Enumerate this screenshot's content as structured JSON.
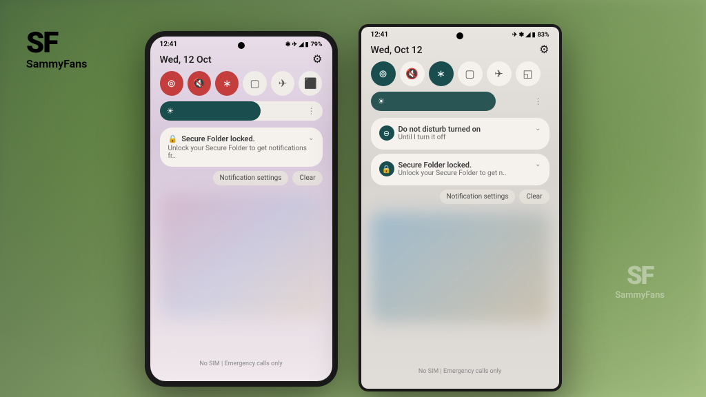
{
  "watermark": {
    "logo": "SF",
    "name": "SammyFans"
  },
  "phone_left": {
    "status": {
      "time": "12:41",
      "icons": "✱ ✈ ◢ ▮",
      "battery": "79%"
    },
    "date": "Wed, 12 Oct",
    "toggles": {
      "wifi": "wifi",
      "mute": "mute",
      "bluetooth": "bluetooth",
      "power": "power-saving",
      "airplane": "airplane",
      "flashlight": "flashlight"
    },
    "notification": {
      "title": "Secure Folder locked.",
      "body": "Unlock your Secure Folder to get notifications fr.."
    },
    "actions": {
      "settings": "Notification settings",
      "clear": "Clear"
    },
    "sim": "No SIM | Emergency calls only"
  },
  "phone_right": {
    "status": {
      "time": "12:41",
      "icons": "✈ ✱ ◢ ▮",
      "battery": "83%"
    },
    "date": "Wed, Oct 12",
    "toggles": {
      "wifi": "wifi",
      "mute": "mute",
      "bluetooth": "bluetooth",
      "power": "power-saving",
      "airplane": "airplane",
      "cast": "cast"
    },
    "notification1": {
      "title": "Do not disturb turned on",
      "body": "Until I turn it off"
    },
    "notification2": {
      "title": "Secure Folder locked.",
      "body": "Unlock your Secure Folder to get n.."
    },
    "actions": {
      "settings": "Notification settings",
      "clear": "Clear"
    },
    "sim": "No SIM | Emergency calls only"
  }
}
